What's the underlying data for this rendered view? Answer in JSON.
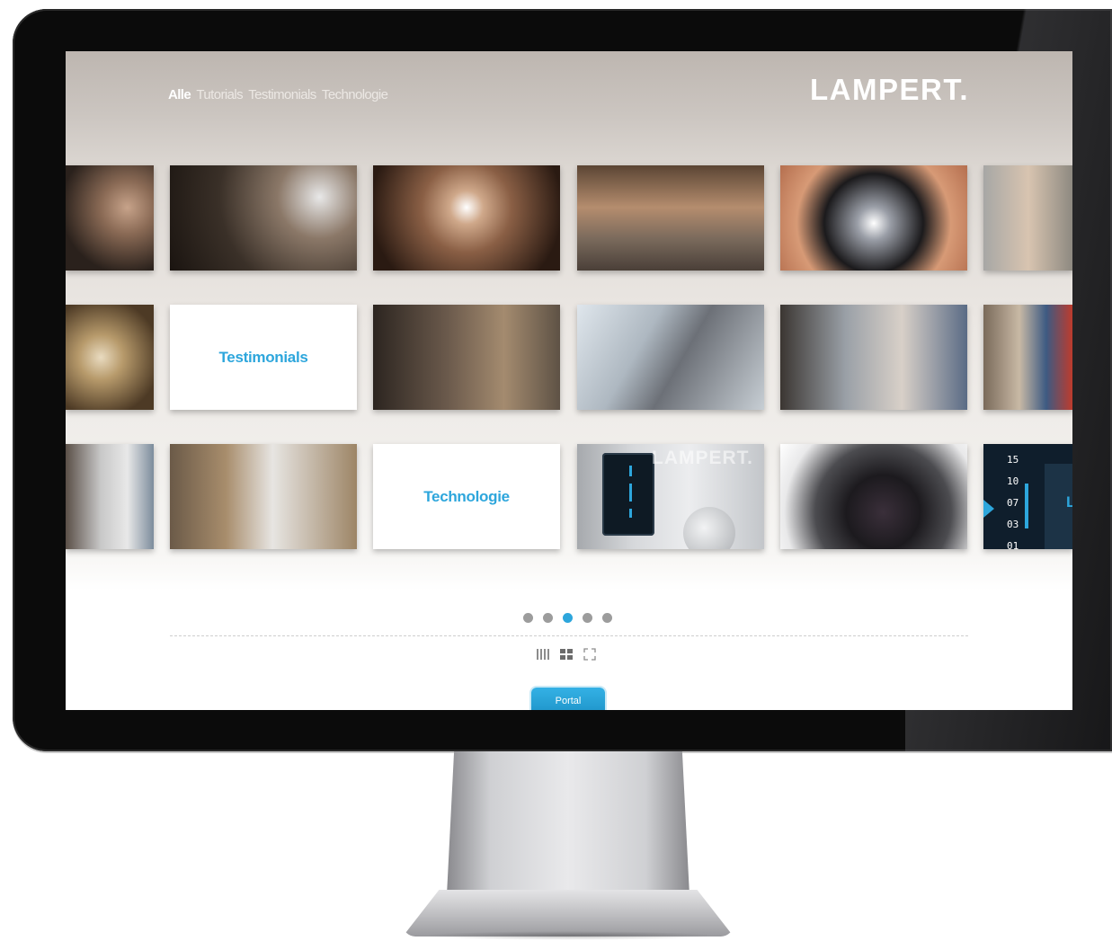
{
  "nav": {
    "items": [
      {
        "label": "Alle",
        "active": true
      },
      {
        "label": "Tutorials",
        "active": false
      },
      {
        "label": "Testimonials",
        "active": false
      },
      {
        "label": "Technologie",
        "active": false
      }
    ]
  },
  "brand": {
    "logo": "LAMPERT."
  },
  "grid": {
    "row1": [
      "jewelry-engraving-video",
      "filigree-welding-video",
      "ring-welding-video",
      "metal-bar-welding-video",
      "welding-tip-video",
      "hand-welding-video"
    ],
    "row2": [
      "jewelry-closeup",
      "Testimonials",
      "microscope-testimonial",
      "workshop-testimonial",
      "craftsman-testimonial",
      "sculptor-testimonial"
    ],
    "row3": [
      "lab-technician",
      "dentist-microscope",
      "Technologie",
      "device-photo",
      "microscope-lens",
      "touchscreen-ui"
    ],
    "testimonials_card": "Testimonials",
    "technologie_card": "Technologie",
    "device_logo": "LAMPERT.",
    "screen_ticks": [
      "15",
      "10",
      "07",
      "03",
      "01"
    ],
    "screen_mark": "L"
  },
  "pager": {
    "pages": 5,
    "current": 3
  },
  "view_modes": [
    "list-view-icon",
    "grid-view-icon",
    "fullscreen-icon"
  ],
  "portal_button": {
    "label": "Portal"
  },
  "colors": {
    "accent": "#2da6dc",
    "header_bg": "#bdb6b0",
    "inactive_dot": "#9c9c9c"
  }
}
